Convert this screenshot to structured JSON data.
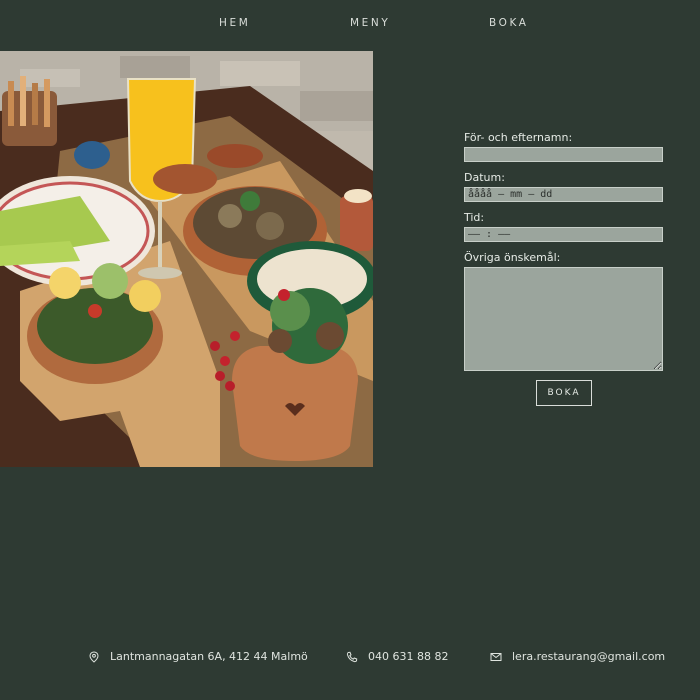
{
  "nav": {
    "home": "HEM",
    "menu": "MENY",
    "book": "BOKA"
  },
  "form": {
    "name_label": "För- och efternamn:",
    "name_value": "",
    "date_label": "Datum:",
    "date_value": "åååå – mm – dd",
    "time_label": "Tid:",
    "time_value": "–– : ––",
    "wishes_label": "Övriga önskemål:",
    "wishes_value": "",
    "submit": "BOKA"
  },
  "footer": {
    "address": "Lantmannagatan 6A, 412 44 Malmö",
    "phone": "040 631 88 82",
    "email": "lera.restaurang@gmail.com",
    "address_icon": "location-pin-icon",
    "phone_icon": "phone-icon",
    "email_icon": "mail-icon"
  },
  "colors": {
    "background": "#2e3a33",
    "field": "#9ba59d",
    "text": "#e4e8e4"
  }
}
